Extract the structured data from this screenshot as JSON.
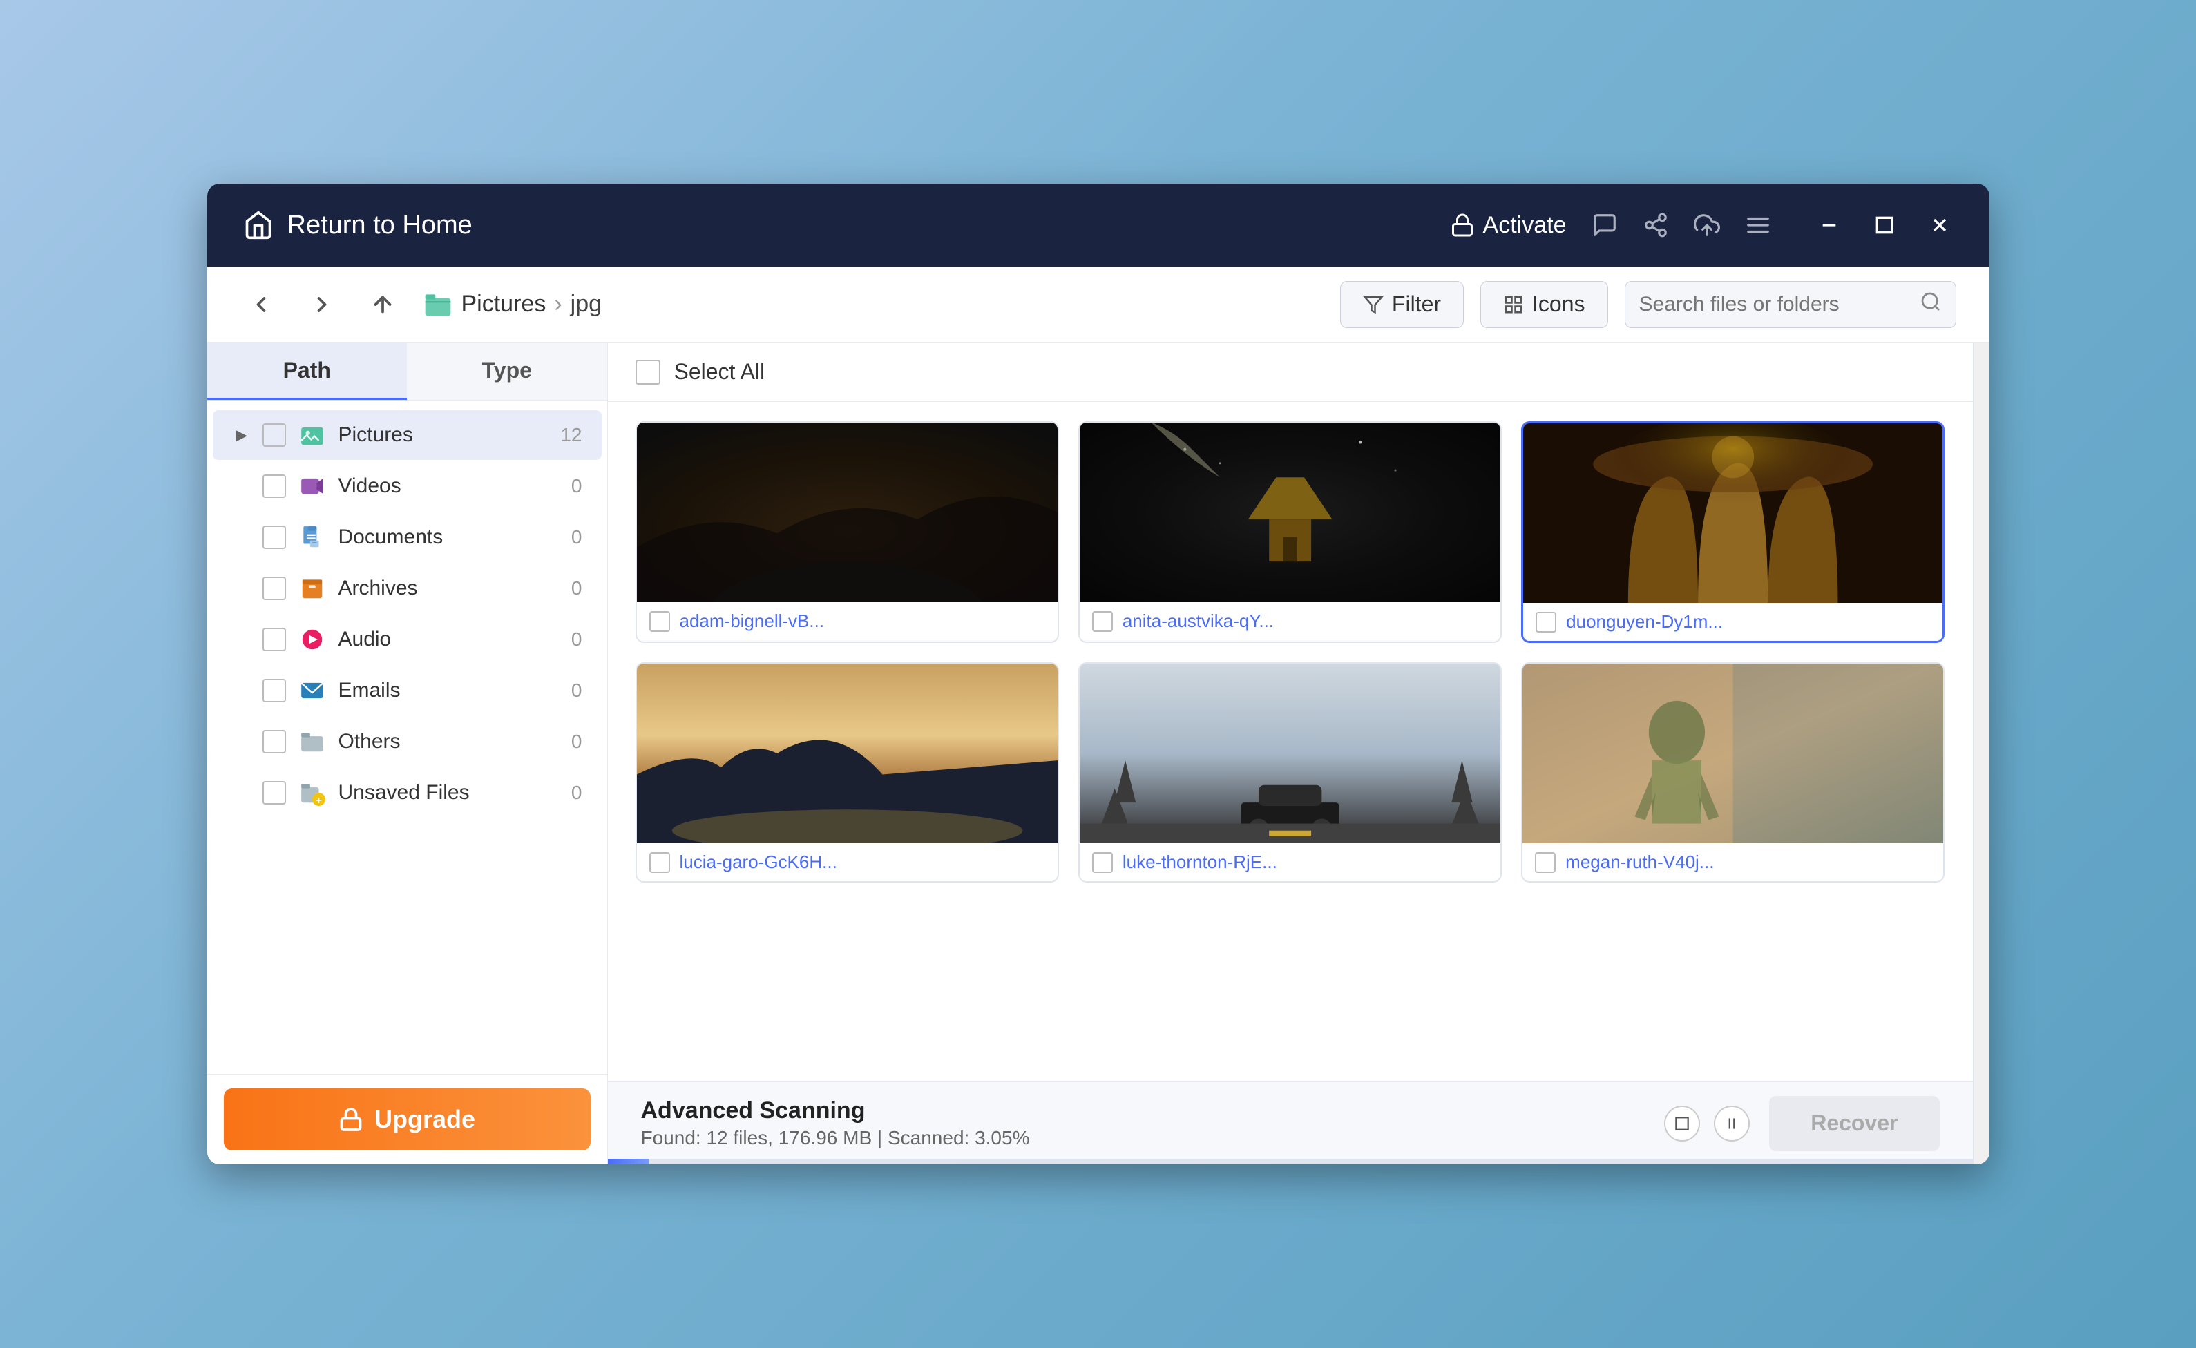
{
  "app": {
    "title": "Return to Home",
    "activate_label": "Activate"
  },
  "toolbar": {
    "breadcrumb": {
      "root": "Pictures",
      "current": "jpg"
    },
    "filter_label": "Filter",
    "icons_label": "Icons",
    "search_placeholder": "Search files or folders"
  },
  "sidebar": {
    "tab_path": "Path",
    "tab_type": "Type",
    "items": [
      {
        "id": "pictures",
        "label": "Pictures",
        "count": "12",
        "icon": "pictures",
        "expanded": true,
        "active": true
      },
      {
        "id": "videos",
        "label": "Videos",
        "count": "0",
        "icon": "videos"
      },
      {
        "id": "documents",
        "label": "Documents",
        "count": "0",
        "icon": "documents"
      },
      {
        "id": "archives",
        "label": "Archives",
        "count": "0",
        "icon": "archives"
      },
      {
        "id": "audio",
        "label": "Audio",
        "count": "0",
        "icon": "audio"
      },
      {
        "id": "emails",
        "label": "Emails",
        "count": "0",
        "icon": "emails"
      },
      {
        "id": "others",
        "label": "Others",
        "count": "0",
        "icon": "others"
      },
      {
        "id": "unsaved",
        "label": "Unsaved Files",
        "count": "0",
        "icon": "unsaved"
      }
    ],
    "upgrade_label": "Upgrade"
  },
  "files": {
    "select_all_label": "Select All",
    "items": [
      {
        "id": "adam",
        "name": "adam-bignell-vB...",
        "thumb_class": "thumb-adam",
        "selected": false
      },
      {
        "id": "anita",
        "name": "anita-austvika-qY...",
        "thumb_class": "thumb-anita",
        "selected": false
      },
      {
        "id": "duong",
        "name": "duonguyen-Dy1m...",
        "thumb_class": "thumb-duong",
        "selected": true
      },
      {
        "id": "lucia",
        "name": "lucia-garo-GcK6H...",
        "thumb_class": "thumb-lucia",
        "selected": false
      },
      {
        "id": "luke",
        "name": "luke-thornton-RjE...",
        "thumb_class": "thumb-luke",
        "selected": false
      },
      {
        "id": "megan",
        "name": "megan-ruth-V40j...",
        "thumb_class": "thumb-megan",
        "selected": false
      }
    ]
  },
  "status": {
    "title": "Advanced Scanning",
    "description": "Found: 12 files, 176.96 MB  |  Scanned: 3.05%",
    "recover_label": "Recover",
    "progress_percent": 3.05
  }
}
